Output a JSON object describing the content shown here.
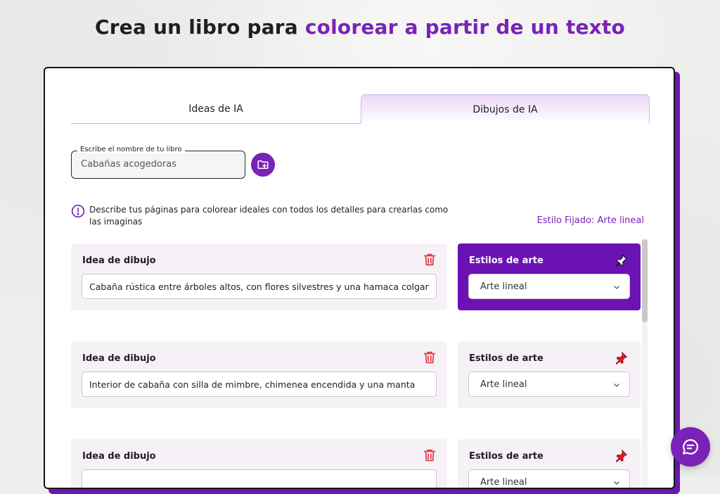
{
  "header": {
    "title_plain": "Crea un libro para",
    "title_accent": "colorear a partir de un texto"
  },
  "tabs": [
    {
      "label": "Ideas de IA",
      "active": false
    },
    {
      "label": "Dibujos de IA",
      "active": true
    }
  ],
  "book_name": {
    "legend": "Escribe el nombre de tu libro",
    "value": "Cabañas acogedoras"
  },
  "info": {
    "text": "Describe tus páginas para colorear ideales con todos los detalles para crearlas como las imaginas",
    "fixed_style": "Estilo Fijado: Arte lineal"
  },
  "rows": [
    {
      "idea_label": "Idea de dibujo",
      "idea_value": "Cabaña rústica entre árboles altos, con flores silvestres y una hamaca colgando",
      "style_label": "Estilos de arte",
      "style_value": "Arte lineal",
      "pinned": true
    },
    {
      "idea_label": "Idea de dibujo",
      "idea_value": "Interior de cabaña con silla de mimbre, chimenea encendida y una manta",
      "style_label": "Estilos de arte",
      "style_value": "Arte lineal",
      "pinned": false
    },
    {
      "idea_label": "Idea de dibujo",
      "idea_value": "",
      "style_label": "Estilos de arte",
      "style_value": "Arte lineal",
      "pinned": false
    }
  ],
  "colors": {
    "accent": "#7a22b8",
    "active_panel": "#6b12b5",
    "trash": "#e0424a",
    "pin_red": "#e21b2b"
  },
  "icons": [
    "folder-add-icon",
    "info-icon",
    "trash-icon",
    "pin-icon",
    "chevron-down-icon",
    "chat-icon"
  ]
}
